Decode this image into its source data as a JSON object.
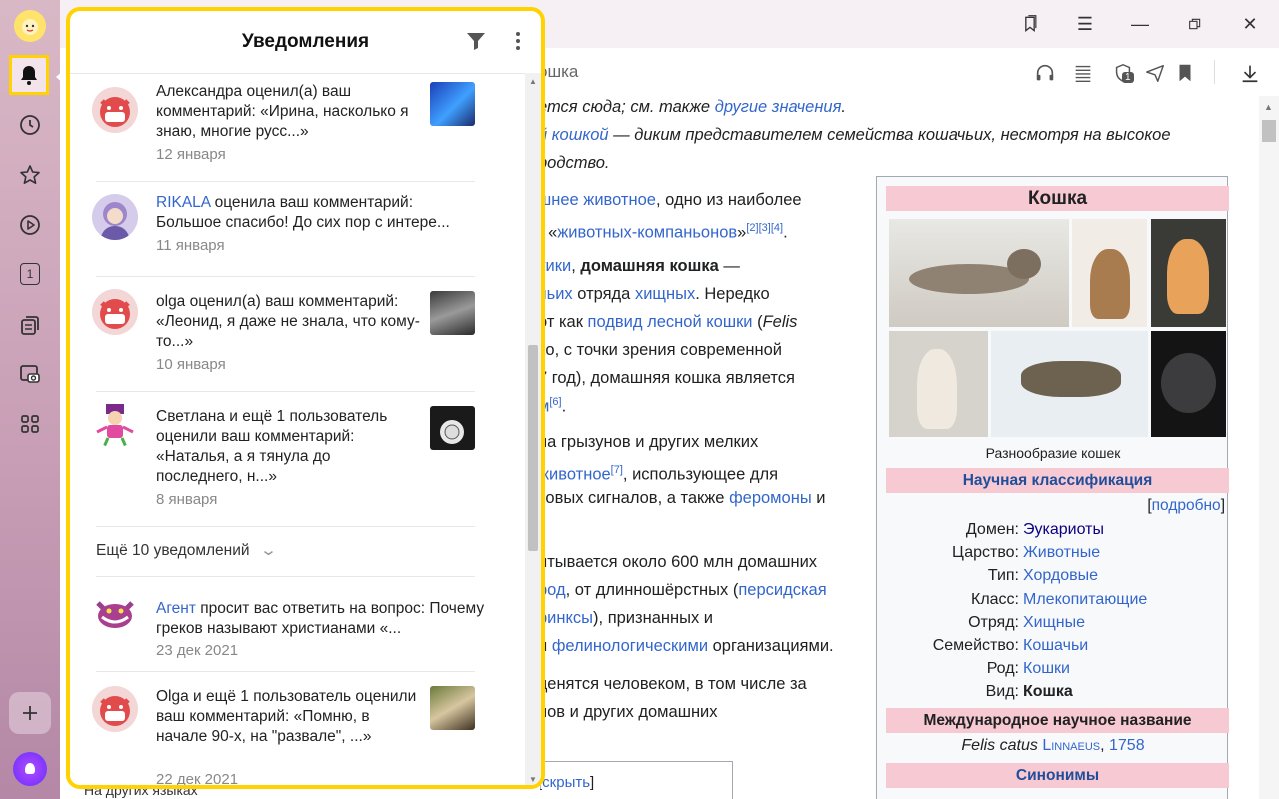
{
  "sidebar": {
    "items": [
      {
        "name": "profile-avatar"
      },
      {
        "name": "notifications",
        "active": true
      },
      {
        "name": "history"
      },
      {
        "name": "bookmarks"
      },
      {
        "name": "video"
      },
      {
        "name": "tab-counter",
        "label": "1"
      },
      {
        "name": "collections"
      },
      {
        "name": "screenshot"
      },
      {
        "name": "services"
      },
      {
        "name": "add"
      },
      {
        "name": "alice"
      }
    ]
  },
  "toolbar": {
    "address_text": "ошка",
    "shield_badge": "1"
  },
  "notifications": {
    "title": "Уведомления",
    "items": [
      {
        "text": "Александра оценил(а) ваш комментарий: «Ирина, насколько я знаю, многие русс...»",
        "date": "12 января"
      },
      {
        "user": "RIKALA",
        "text": " оценила ваш комментарий: Большое спасибо! До сих пор с интере...",
        "date": "11 января"
      },
      {
        "text": "olga оценил(а) ваш комментарий: «Леонид, я даже не знала, что кому-то...»",
        "date": "10 января"
      },
      {
        "text": "Светлана и ещё 1 пользователь оценили ваш комментарий: «Наталья, а я тянула до последнего, н...»",
        "date": "8 января"
      },
      {
        "user": "Агент",
        "text": " просит вас ответить на вопрос: Почему греков называют христианами «...",
        "date": "23 дек 2021"
      },
      {
        "text": "Olga и ещё 1 пользователь оценили ваш комментарий: «Помню, в начале 90-х, на \"развале\", ...»",
        "date": "22 дек 2021"
      }
    ],
    "more_label": "Ещё 10 уведомлений"
  },
  "article": {
    "line1_a": "ется сюда; см. также ",
    "line1_link": "другие значения",
    "line1_b": ".",
    "line2_link": "й кошкой",
    "line2_b": " — диким представителем семейства кошачьих, несмотря на высокое",
    "line3": "родство.",
    "p1_l1_link": "шнее животное",
    "p1_l1_b": ", одно из наиболее",
    "p1_l2_a": ") «",
    "p1_l2_link": "животных-компаньонов",
    "p1_l2_b": "»",
    "p1_l2_refs": "[2][3][4]",
    "p2_l1_link": "тики",
    "p2_l1_b": ", ",
    "p2_l1_bold": "домашняя кошка",
    "p2_l1_c": " —",
    "p2_l2_link": "чьих",
    "p2_l2_b": " отряда ",
    "p2_l2_link2": "хищных",
    "p2_l2_c": ". Нередко",
    "p2_l3_a": "от как ",
    "p2_l3_link": "подвид лесной кошки",
    "p2_l3_b": " (",
    "p2_l3_it": "Felis",
    "p2_l4": "ко, с точки зрения современной",
    "p2_l5": "7 год), домашняя кошка является",
    "p2_l6_link": "м",
    "p2_l6_ref": "[6]",
    "p2_l6_b": ".",
    "p3_l1": "на грызунов и других мелких",
    "p3_l2_link": "животное",
    "p3_l2_ref": "[7]",
    "p3_l2_b": ", использующее для",
    "p3_l3_a": "ковых сигналов, а также ",
    "p3_l3_link": "феромоны",
    "p3_l3_b": " и",
    "p4_l1": "итывается около 600 млн домашних",
    "p4_l2_link": "род",
    "p4_l2_b": ", от длинношёрстных (",
    "p4_l2_link2": "персидская",
    "p4_l3_link": "ринксы",
    "p4_l3_b": "), признанных и",
    "p4_l4_a": "и ",
    "p4_l4_link": "фелинологическими",
    "p4_l4_b": " организациями.",
    "p5_l1": "ценятся человеком, в том числе за",
    "p5_l2": "нов и других домашних",
    "hide_label": "скрыть",
    "other_langs": "На других языках"
  },
  "infobox": {
    "title": "Кошка",
    "caption": "Разнообразие кошек",
    "sci_class_header": "Научная классификация",
    "more_link": "подробно",
    "rows": [
      {
        "k": "Домен:",
        "v": "Эукариоты"
      },
      {
        "k": "Царство:",
        "v": "Животные"
      },
      {
        "k": "Тип:",
        "v": "Хордовые"
      },
      {
        "k": "Класс:",
        "v": "Млекопитающие"
      },
      {
        "k": "Отряд:",
        "v": "Хищные"
      },
      {
        "k": "Семейство:",
        "v": "Кошачьи"
      },
      {
        "k": "Род:",
        "v": "Кошки"
      },
      {
        "k": "Вид:",
        "v": "Кошка"
      }
    ],
    "intl_name_header": "Международное научное название",
    "latin_name": "Felis catus",
    "author": "Linnaeus",
    "year": "1758",
    "synonyms_header": "Синонимы"
  },
  "colors": {
    "highlight": "#ffd200",
    "link": "#3366cc",
    "infobox_header": "#f7c9d2"
  }
}
